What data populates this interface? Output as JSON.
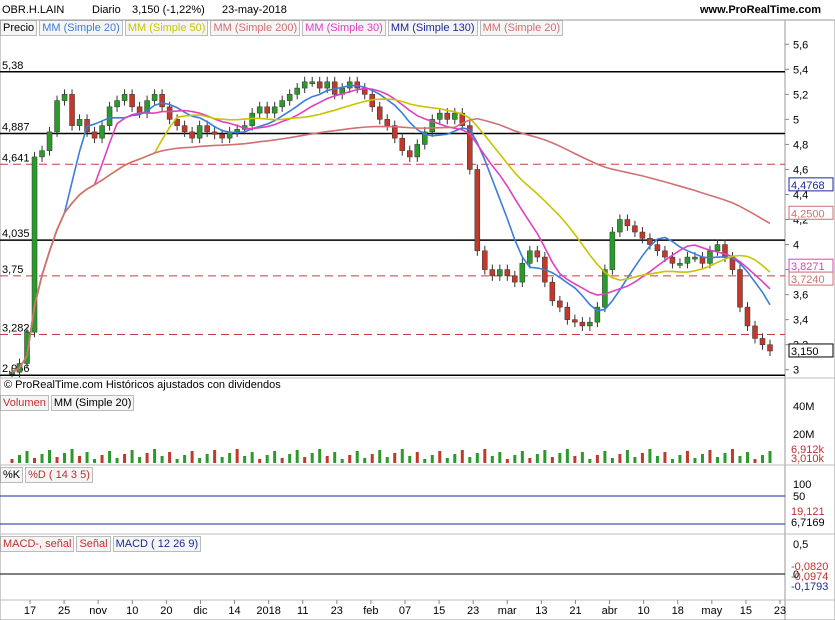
{
  "header": {
    "ticker": "OBR.H.LAIN",
    "period": "Diario",
    "last": "3,150 (-1,22%)",
    "date": "23-may-2018",
    "site": "www.ProRealTime.com"
  },
  "legend": {
    "price": "Precio",
    "ma20": "MM (Simple 20)",
    "ma50": "MM (Simple 50)",
    "ma200": "MM (Simple 200)",
    "ma30": "MM (Simple 30)",
    "ma130": "MM (Simple 130)",
    "ma20b": "MM (Simple 20)"
  },
  "colors": {
    "up": "#2a9a2a",
    "down": "#c0392b",
    "ma20": "#3b7dd8",
    "ma50": "#c8c400",
    "ma200": "#d07070",
    "ma30": "#e040c0",
    "ma130": "#1a2a9a",
    "level_solid": "#000000",
    "level_dash": "#c04040"
  },
  "copyright": "© ProRealTime.com  Históricos ajustados con dividendos",
  "chart_data": {
    "type": "candlestick",
    "y_axis_ticks": [
      "5,6",
      "5,4",
      "5,2",
      "5",
      "4,8",
      "4,6",
      "4,4",
      "4,2",
      "4",
      "3,8",
      "3,6",
      "3,4",
      "3,2",
      "3"
    ],
    "ylim": [
      2.95,
      5.65
    ],
    "levels": [
      {
        "label": "5,38",
        "value": 5.38,
        "style": "solid"
      },
      {
        "label": "4,887",
        "value": 4.887,
        "style": "solid"
      },
      {
        "label": "4,641",
        "value": 4.641,
        "style": "dash"
      },
      {
        "label": "4,035",
        "value": 4.035,
        "style": "solid"
      },
      {
        "label": "3,75",
        "value": 3.75,
        "style": "dash"
      },
      {
        "label": "3,282",
        "value": 3.282,
        "style": "dash"
      },
      {
        "label": "2,956",
        "value": 2.956,
        "style": "solid"
      }
    ],
    "right_labels": [
      {
        "label": "4,4768",
        "value": 4.4768,
        "color": "#1a2a9a"
      },
      {
        "label": "4,2500",
        "value": 4.25,
        "color": "#d07070"
      },
      {
        "label": "3,8271",
        "value": 3.8271,
        "color": "#e040c0"
      },
      {
        "label": "3,7240",
        "value": 3.724,
        "color": "#d07070"
      },
      {
        "label": "3,150",
        "value": 3.15,
        "color": "#000000"
      }
    ],
    "x_tick_labels": [
      "17",
      "25",
      "nov",
      "10",
      "20",
      "dic",
      "14",
      "2018",
      "11",
      "23",
      "feb",
      "07",
      "15",
      "23",
      "mar",
      "13",
      "21",
      "abr",
      "10",
      "18",
      "may",
      "15",
      "23"
    ],
    "closes": [
      2.98,
      3.05,
      3.3,
      4.7,
      4.75,
      4.9,
      5.15,
      5.2,
      4.95,
      5.0,
      4.9,
      4.85,
      4.95,
      5.1,
      5.15,
      5.2,
      5.1,
      5.05,
      5.15,
      5.2,
      5.1,
      5.0,
      4.95,
      4.9,
      4.85,
      4.95,
      4.9,
      4.88,
      4.85,
      4.9,
      4.92,
      4.95,
      5.05,
      5.1,
      5.05,
      5.1,
      5.15,
      5.2,
      5.25,
      5.3,
      5.3,
      5.25,
      5.3,
      5.2,
      5.25,
      5.3,
      5.25,
      5.2,
      5.1,
      5.0,
      4.95,
      4.85,
      4.75,
      4.7,
      4.8,
      4.9,
      5.0,
      5.05,
      5.0,
      5.05,
      4.95,
      4.6,
      3.95,
      3.8,
      3.75,
      3.8,
      3.75,
      3.7,
      3.85,
      3.95,
      3.9,
      3.7,
      3.55,
      3.5,
      3.4,
      3.38,
      3.35,
      3.38,
      3.5,
      3.8,
      4.1,
      4.2,
      4.15,
      4.1,
      4.05,
      4.0,
      3.95,
      3.9,
      3.85,
      3.85,
      3.9,
      3.9,
      3.85,
      3.95,
      4.0,
      3.9,
      3.8,
      3.5,
      3.35,
      3.25,
      3.2,
      3.15
    ],
    "volume": {
      "labels": [
        "40M",
        "20M"
      ],
      "values": [
        {
          "label": "6,912k"
        },
        {
          "label": "3,010k"
        }
      ]
    },
    "stoch": {
      "labels": [
        "100",
        "50"
      ],
      "k_label": "%K",
      "d_label": "%D ( 14 3 5)",
      "values": [
        {
          "label": "19,121"
        },
        {
          "label": "6,7169"
        }
      ]
    },
    "macd": {
      "labels": [
        "0,5",
        "0"
      ],
      "legend": [
        "MACD-, señal",
        "Señal",
        "MACD ( 12 26 9)"
      ],
      "values": [
        {
          "label": "-0,0820"
        },
        {
          "label": "-0,0974"
        },
        {
          "label": "-0,1793"
        }
      ]
    }
  }
}
